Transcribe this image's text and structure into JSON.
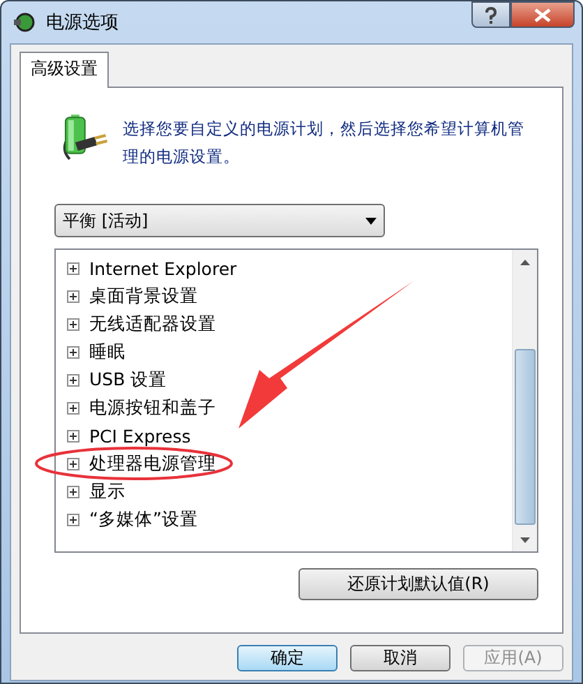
{
  "window": {
    "title": "电源选项"
  },
  "tabs": [
    {
      "label": "高级设置",
      "selected": true
    }
  ],
  "intro": "选择您要自定义的电源计划，然后选择您希望计算机管理的电源设置。",
  "plan_dropdown": {
    "value": "平衡 [活动]"
  },
  "settings_tree": [
    {
      "label": "Internet Explorer",
      "expanded": false
    },
    {
      "label": "桌面背景设置",
      "expanded": false
    },
    {
      "label": "无线适配器设置",
      "expanded": false
    },
    {
      "label": "睡眠",
      "expanded": false
    },
    {
      "label": "USB 设置",
      "expanded": false
    },
    {
      "label": "电源按钮和盖子",
      "expanded": false
    },
    {
      "label": "PCI Express",
      "expanded": false
    },
    {
      "label": "处理器电源管理",
      "expanded": false
    },
    {
      "label": "显示",
      "expanded": false
    },
    {
      "label": "“多媒体”设置",
      "expanded": false
    }
  ],
  "restore_button": "还原计划默认值(R)",
  "buttons": [
    {
      "label": "确定",
      "default": true,
      "disabled": false
    },
    {
      "label": "取消",
      "default": false,
      "disabled": false
    },
    {
      "label": "应用(A)",
      "default": false,
      "disabled": true
    }
  ]
}
